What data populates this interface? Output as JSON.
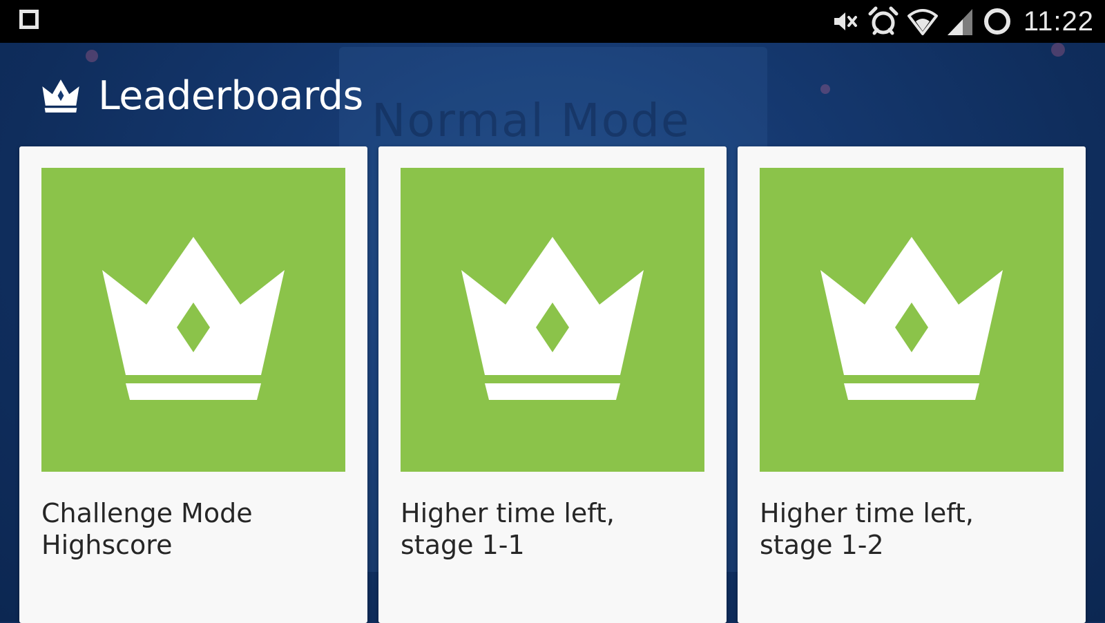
{
  "status_bar": {
    "time": "11:22",
    "icons": [
      "recents-square-icon",
      "mute-icon",
      "alarm-icon",
      "wifi-icon",
      "cell-signal-icon",
      "sync-ring-icon"
    ]
  },
  "background": {
    "mode_text": "Normal Mode"
  },
  "app_bar": {
    "icon": "crown-icon",
    "title": "Leaderboards"
  },
  "cards": [
    {
      "title_line1": "Challenge Mode",
      "title_line2": "Highscore",
      "icon": "crown-icon",
      "art_color": "#8bc34a"
    },
    {
      "title_line1": "Higher time left,",
      "title_line2": "stage 1-1",
      "icon": "crown-icon",
      "art_color": "#8bc34a"
    },
    {
      "title_line1": "Higher time left,",
      "title_line2": "stage 1-2",
      "icon": "crown-icon",
      "art_color": "#8bc34a"
    }
  ],
  "colors": {
    "accent": "#8bc34a",
    "background": "#0f2d5c",
    "card": "#f8f8f8"
  }
}
